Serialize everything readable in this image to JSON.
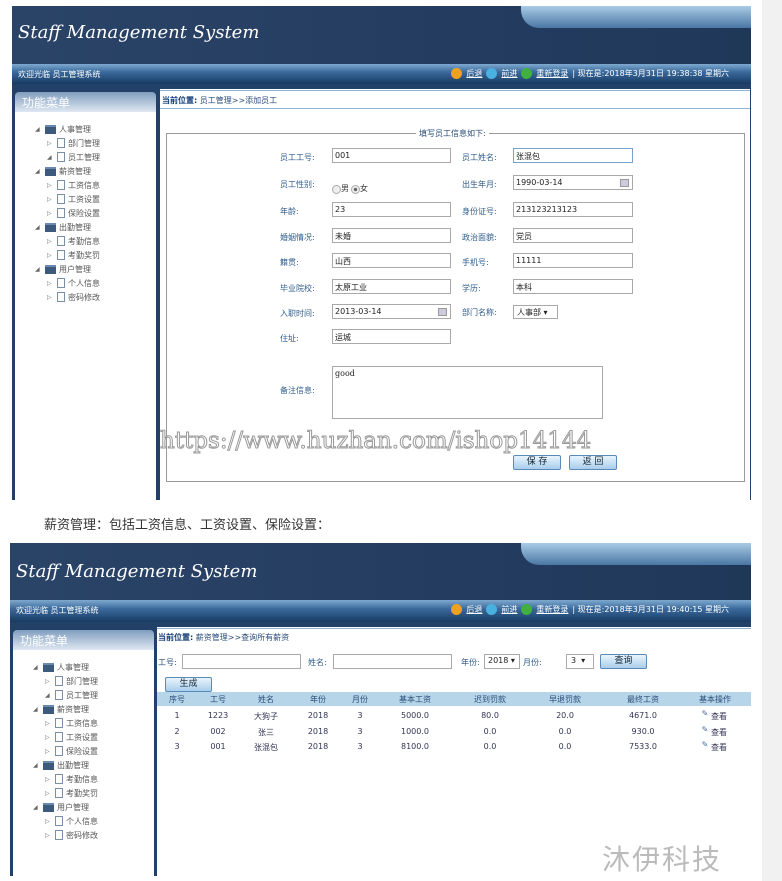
{
  "app_title": "Staff Management System",
  "welcome": "欢迎光临 员工管理系统",
  "nav": {
    "back": "后退",
    "forward": "前进",
    "relogin": "重新登录"
  },
  "menu_title": "功能菜单",
  "menu": [
    {
      "label": "人事管理",
      "type": "folder"
    },
    {
      "label": "部门管理",
      "type": "file"
    },
    {
      "label": "员工管理",
      "type": "file",
      "open": true
    },
    {
      "label": "薪资管理",
      "type": "folder"
    },
    {
      "label": "工资信息",
      "type": "file"
    },
    {
      "label": "工资设置",
      "type": "file"
    },
    {
      "label": "保险设置",
      "type": "file"
    },
    {
      "label": "出勤管理",
      "type": "folder"
    },
    {
      "label": "考勤信息",
      "type": "file"
    },
    {
      "label": "考勤奖罚",
      "type": "file"
    },
    {
      "label": "用户管理",
      "type": "folder"
    },
    {
      "label": "个人信息",
      "type": "file"
    },
    {
      "label": "密码修改",
      "type": "file"
    }
  ],
  "screen1": {
    "clock": "| 现在是:2018年3月31日 19:38:38 星期六",
    "crumb_label": "当前位置:",
    "crumb": "员工管理>>添加员工",
    "legend": "填写员工信息如下:",
    "fields": {
      "emp_no": {
        "label": "员工工号:",
        "value": "001"
      },
      "emp_name": {
        "label": "员工姓名:",
        "value": "张混包"
      },
      "gender": {
        "label": "员工性别:",
        "male": "男",
        "female": "女",
        "selected": "女"
      },
      "birth": {
        "label": "出生年月:",
        "value": "1990-03-14"
      },
      "age": {
        "label": "年龄:",
        "value": "23"
      },
      "id_no": {
        "label": "身份证号:",
        "value": "213123213123"
      },
      "marriage": {
        "label": "婚姻情况:",
        "value": "未婚"
      },
      "politics": {
        "label": "政治面貌:",
        "value": "党员"
      },
      "native": {
        "label": "籍贯:",
        "value": "山西"
      },
      "phone": {
        "label": "手机号:",
        "value": "11111"
      },
      "school": {
        "label": "毕业院校:",
        "value": "太原工业"
      },
      "edu": {
        "label": "学历:",
        "value": "本科"
      },
      "hire": {
        "label": "入职时间:",
        "value": "2013-03-14"
      },
      "dept": {
        "label": "部门名称:",
        "value": "人事部"
      },
      "addr": {
        "label": "住址:",
        "value": "运城"
      },
      "remark": {
        "label": "备注信息:",
        "value": "good"
      }
    },
    "save": "保 存",
    "back": "返 回"
  },
  "watermark_url": "https://www.huzhan.com/ishop14144",
  "caption": "薪资管理：包括工资信息、工资设置、保险设置：",
  "screen2": {
    "clock": "| 现在是:2018年3月31日 19:40:15 星期六",
    "crumb_label": "当前位置:",
    "crumb": "薪资管理>>查询所有薪资",
    "filter": {
      "no_label": "工号:",
      "no_value": "",
      "name_label": "姓名:",
      "name_value": "",
      "year_label": "年份:",
      "year": "2018",
      "month_label": "月份:",
      "month": "3",
      "query": "查询"
    },
    "generate": "生成",
    "columns": [
      "序号",
      "工号",
      "姓名",
      "年份",
      "月份",
      "基本工资",
      "迟到罚款",
      "早退罚款",
      "最终工资",
      "基本操作"
    ],
    "rows": [
      [
        "1",
        "1223",
        "大狗子",
        "2018",
        "3",
        "5000.0",
        "80.0",
        "20.0",
        "4671.0",
        "查看"
      ],
      [
        "2",
        "002",
        "张三",
        "2018",
        "3",
        "1000.0",
        "0.0",
        "0.0",
        "930.0",
        "查看"
      ],
      [
        "3",
        "001",
        "张混包",
        "2018",
        "3",
        "8100.0",
        "0.0",
        "0.0",
        "7533.0",
        "查看"
      ]
    ]
  },
  "brand_watermark": "沐伊科技"
}
